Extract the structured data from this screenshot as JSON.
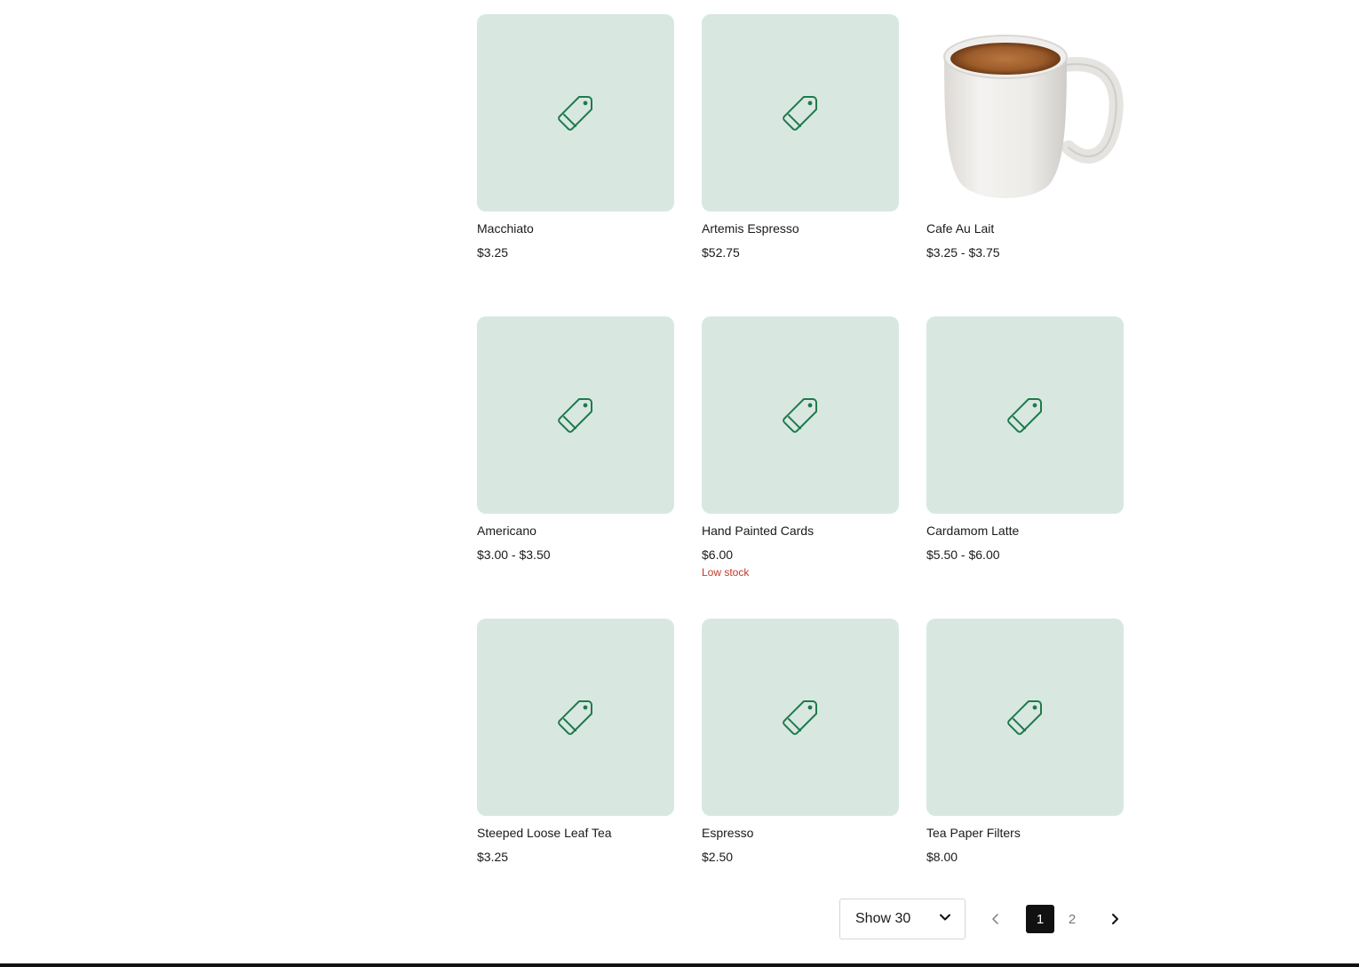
{
  "colors": {
    "tile_background": "#d8e8e0",
    "tag_icon": "#1f7a4d",
    "low_stock": "#c0392b",
    "active_page": "#111111"
  },
  "products": [
    {
      "name": "Macchiato",
      "price": "$3.25",
      "image": "tag-icon"
    },
    {
      "name": "Artemis Espresso",
      "price": "$52.75",
      "image": "tag-icon"
    },
    {
      "name": "Cafe Au Lait",
      "price": "$3.25 - $3.75",
      "image": "coffee-mug-photo"
    },
    {
      "name": "Americano",
      "price": "$3.00 - $3.50",
      "image": "tag-icon"
    },
    {
      "name": "Hand Painted Cards",
      "price": "$6.00",
      "stock": "Low stock",
      "image": "tag-icon"
    },
    {
      "name": "Cardamom Latte",
      "price": "$5.50 - $6.00",
      "image": "tag-icon"
    },
    {
      "name": "Steeped Loose Leaf Tea",
      "price": "$3.25",
      "image": "tag-icon"
    },
    {
      "name": "Espresso",
      "price": "$2.50",
      "image": "tag-icon"
    },
    {
      "name": "Tea Paper Filters",
      "price": "$8.00",
      "image": "tag-icon"
    }
  ],
  "footer": {
    "page_size_label": "Show 30",
    "pages": [
      "1",
      "2"
    ],
    "current_page": "1",
    "prev_icon": "chevron-left-icon",
    "next_icon": "chevron-right-icon"
  }
}
